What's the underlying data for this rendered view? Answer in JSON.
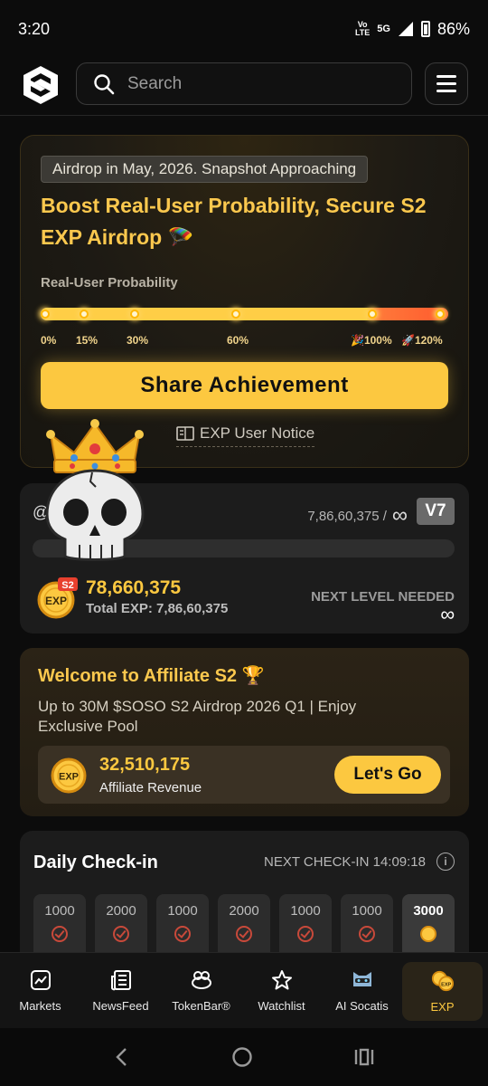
{
  "status": {
    "time": "3:20",
    "network": "Vo LTE 5G",
    "battery": "86%"
  },
  "header": {
    "search_placeholder": "Search"
  },
  "airdrop": {
    "pill": "Airdrop in May, 2026. Snapshot Approaching",
    "title": "Boost Real-User Probability, Secure S2 EXP Airdrop 🪂",
    "probability_label": "Real-User Probability",
    "ticks": [
      "0%",
      "15%",
      "30%",
      "60%",
      "🎉100%",
      "🚀120%"
    ],
    "share_label": "Share Achievement",
    "notice_label": "EXP User Notice"
  },
  "level": {
    "username_prefix": "@",
    "count": "7,86,60,375 /",
    "count_max": "∞",
    "badge": "V7",
    "season_tag": "S2",
    "exp_value": "78,660,375",
    "total_exp": "Total EXP: 7,86,60,375",
    "next_label": "NEXT LEVEL NEEDED",
    "next_value": "∞"
  },
  "affiliate": {
    "title": "Welcome to Affiliate S2 🏆",
    "subtitle": "Up to 30M $SOSO S2 Airdrop 2026 Q1 | Enjoy Exclusive Pool",
    "revenue_value": "32,510,175",
    "revenue_label": "Affiliate Revenue",
    "cta": "Let's Go"
  },
  "checkin": {
    "title": "Daily Check-in",
    "next": "NEXT CHECK-IN 14:09:18",
    "days": [
      "1000",
      "2000",
      "1000",
      "2000",
      "1000",
      "1000",
      "3000"
    ]
  },
  "tabs": [
    {
      "label": "Markets",
      "icon": "chart-icon"
    },
    {
      "label": "NewsFeed",
      "icon": "newspaper-icon"
    },
    {
      "label": "TokenBar®",
      "icon": "tokenbar-icon"
    },
    {
      "label": "Watchlist",
      "icon": "star-icon"
    },
    {
      "label": "AI Socatis",
      "icon": "cat-avatar-icon"
    },
    {
      "label": "EXP",
      "icon": "exp-coin-icon"
    }
  ],
  "colors": {
    "accent": "#fcc840",
    "background": "#0c0c0c",
    "card": "#1c1c1c"
  }
}
